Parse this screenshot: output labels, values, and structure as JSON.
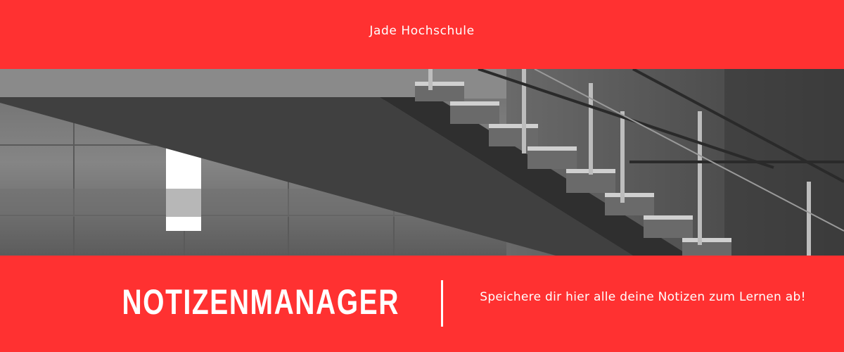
{
  "header": {
    "institution": "Jade Hochschule"
  },
  "hero": {
    "image": "staircase-photo"
  },
  "banner": {
    "title": "NOTIZENMANAGER",
    "tagline": "Speichere dir hier alle deine Notizen zum Lernen ab!"
  },
  "colors": {
    "brand_red": "#ff3131",
    "text": "#ffffff"
  }
}
